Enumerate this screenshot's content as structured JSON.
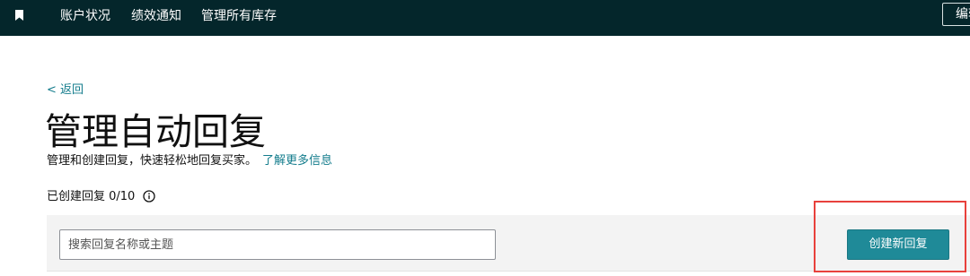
{
  "topbar": {
    "bookmark_icon": "bookmark-icon",
    "nav_items": [
      "账户状况",
      "绩效通知",
      "管理所有库存"
    ],
    "edit_label": "编辑"
  },
  "back_link": "< 返回",
  "title": "管理自动回复",
  "subtitle": {
    "text": "管理和创建回复，快速轻松地回复买家。",
    "link": "了解更多信息"
  },
  "count": {
    "label": "已创建回复 0/10",
    "icon": "info-icon"
  },
  "search": {
    "placeholder": "搜索回复名称或主题",
    "value": ""
  },
  "create_button": "创建新回复",
  "colors": {
    "topbar": "#04262b",
    "link": "#137c8c",
    "primary_button": "#1f8a98",
    "highlight": "#e8413c"
  }
}
